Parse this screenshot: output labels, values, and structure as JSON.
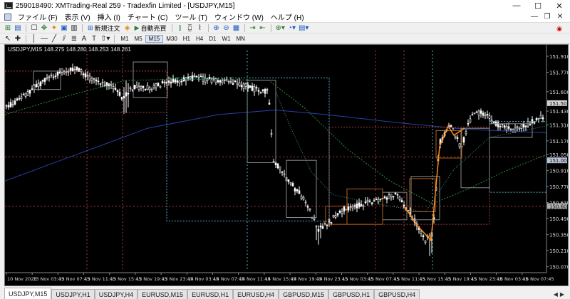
{
  "window": {
    "title": "259018490: XMTrading-Real 259 - Tradexfin Limited - [USDJPY,M15]",
    "controls": [
      "—",
      "☐",
      "✕"
    ]
  },
  "menu": {
    "items": [
      "ファイル (F)",
      "表示 (V)",
      "挿入 (I)",
      "チャート (C)",
      "ツール (T)",
      "ウィンドウ (W)",
      "ヘルプ (H)"
    ],
    "mdi_controls": [
      "—",
      "❐",
      "✕"
    ]
  },
  "toolbar": {
    "new_order_label": "新規注文",
    "autotrade_label": "自動売買",
    "timeframes": [
      "M1",
      "M5",
      "M15",
      "M30",
      "H1",
      "H4",
      "D1",
      "W1",
      "MN"
    ],
    "active_timeframe": "M15"
  },
  "chart": {
    "header": "USDJPY,M15  148.275 148.280 148.253 148.261",
    "price_labels": [
      "151.910",
      "151.770",
      "151.600",
      "151.430",
      "151.310",
      "151.170",
      "151.050",
      "150.910",
      "150.770",
      "150.630",
      "150.490",
      "150.350",
      "150.210",
      "150.070"
    ],
    "highlight_labels": [
      {
        "text": "151.500",
        "bg": "#d0d0d0"
      },
      {
        "text": "151.000",
        "bg": "#b9c3d6"
      },
      {
        "text": "150.600",
        "bg": "#b0b0b0"
      }
    ],
    "time_labels": [
      "10 Nov 2023",
      "13 Nov 03:45",
      "13 Nov 07:45",
      "13 Nov 11:45",
      "13 Nov 15:45",
      "13 Nov 19:45",
      "13 Nov 23:45",
      "14 Nov 03:45",
      "14 Nov 07:45",
      "14 Nov 11:45",
      "14 Nov 15:45",
      "14 Nov 19:45",
      "14 Nov 23:45",
      "15 Nov 03:45",
      "15 Nov 07:45",
      "15 Nov 11:45",
      "15 Nov 15:45",
      "15 Nov 19:45",
      "15 Nov 23:45",
      "16 Nov 03:45",
      "16 Nov 07:45"
    ],
    "colors": {
      "background": "#000000",
      "candle": "#ffffff",
      "ma_blue": "#2a3fa8",
      "ma_green": "#2f8f3a",
      "ma_teal": "#3a9a8a",
      "zone_red": "#b23a3a",
      "zone_cyan": "#4fb6c9",
      "zone_gray": "#8a8a8a",
      "zone_orange": "#b5601a",
      "zigzag_orange": "#ff8c1a"
    }
  },
  "tabs": {
    "items": [
      "USDJPY,M15",
      "USDJPY,H1",
      "USDJPY,H4",
      "EURUSD,M15",
      "EURUSD,H1",
      "EURUSD,H4",
      "GBPUSD,M15",
      "GBPUSD,H1",
      "GBPUSD,H4"
    ],
    "active": 0
  }
}
